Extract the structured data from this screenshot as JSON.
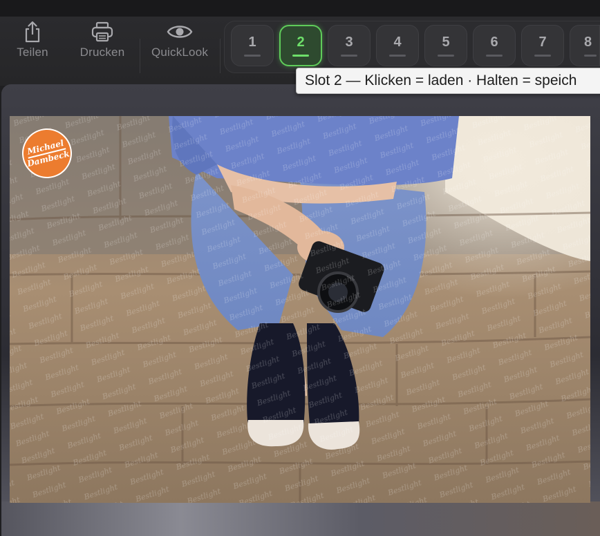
{
  "toolbar": {
    "share_label": "Teilen",
    "print_label": "Drucken",
    "quicklook_label": "QuickLook"
  },
  "slots": {
    "active": 2,
    "items": [
      {
        "label": "1"
      },
      {
        "label": "2"
      },
      {
        "label": "3"
      },
      {
        "label": "4"
      },
      {
        "label": "5"
      },
      {
        "label": "6"
      },
      {
        "label": "7"
      },
      {
        "label": "8"
      }
    ]
  },
  "tooltip": {
    "text": "Slot 2 — Klicken = laden · Halten = speich"
  },
  "photo": {
    "logo_line1": "Michael",
    "logo_line2": "Dambeck",
    "watermark": "Bestlight"
  },
  "colors": {
    "accent_active": "#5fcc5a",
    "logo_orange": "#ec7c2f"
  },
  "icons": [
    "share-icon",
    "print-icon",
    "eye-icon"
  ]
}
